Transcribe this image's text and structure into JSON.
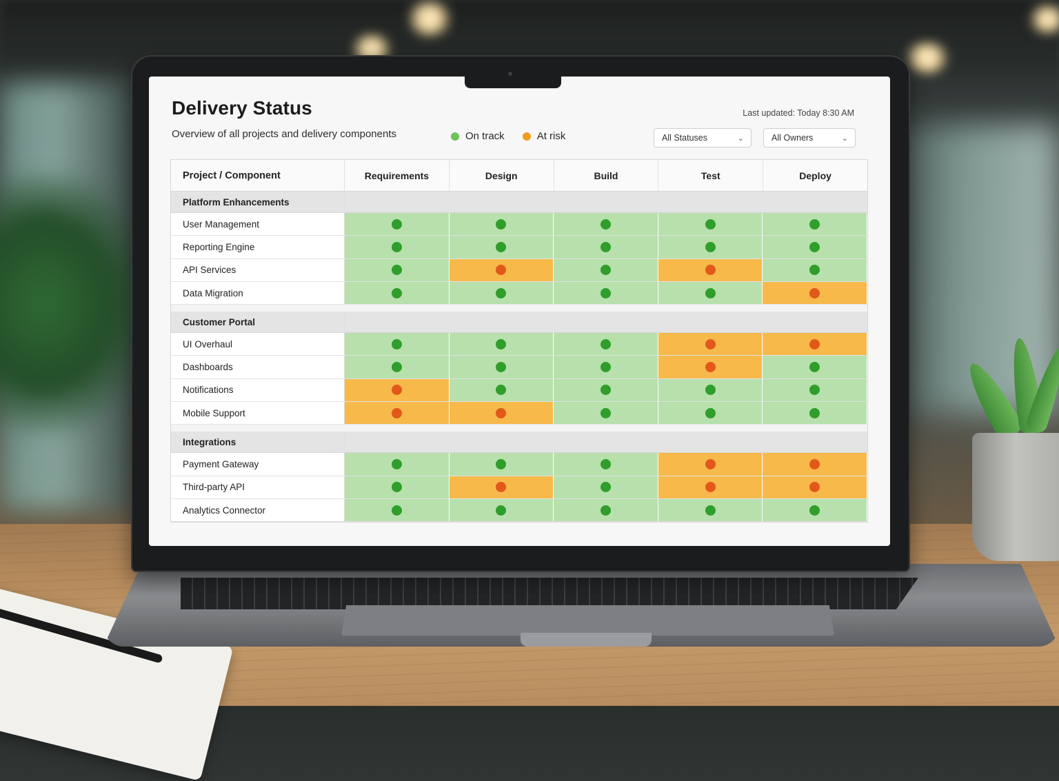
{
  "app": {
    "title": "Delivery Status",
    "subtitle": "Overview of all projects and delivery components",
    "last_updated": "Last updated: Today 8:30 AM"
  },
  "legend": [
    {
      "label": "On track",
      "color": "#6cc45a"
    },
    {
      "label": "At risk",
      "color": "#f39c23"
    }
  ],
  "filters": {
    "status": "All Statuses",
    "owner": "All Owners"
  },
  "colors": {
    "on_track_bg": "#b7e0ad",
    "on_track_dot": "#2f9e2a",
    "at_risk_bg": "#f6b94a",
    "at_risk_dot": "#e2581b"
  },
  "table": {
    "first_col_header": "Project / Component",
    "columns": [
      "Requirements",
      "Design",
      "Build",
      "Test",
      "Deploy"
    ],
    "groups": [
      {
        "name": "Platform Enhancements",
        "rows": [
          {
            "label": "User Management",
            "status": [
              "on_track",
              "on_track",
              "on_track",
              "on_track",
              "on_track"
            ]
          },
          {
            "label": "Reporting Engine",
            "status": [
              "on_track",
              "on_track",
              "on_track",
              "on_track",
              "on_track"
            ]
          },
          {
            "label": "API Services",
            "status": [
              "on_track",
              "at_risk",
              "on_track",
              "at_risk",
              "on_track"
            ]
          },
          {
            "label": "Data Migration",
            "status": [
              "on_track",
              "on_track",
              "on_track",
              "on_track",
              "at_risk"
            ]
          }
        ]
      },
      {
        "name": "Customer Portal",
        "rows": [
          {
            "label": "UI Overhaul",
            "status": [
              "on_track",
              "on_track",
              "on_track",
              "at_risk",
              "at_risk"
            ]
          },
          {
            "label": "Dashboards",
            "status": [
              "on_track",
              "on_track",
              "on_track",
              "at_risk",
              "on_track"
            ]
          },
          {
            "label": "Notifications",
            "status": [
              "at_risk",
              "on_track",
              "on_track",
              "on_track",
              "on_track"
            ]
          },
          {
            "label": "Mobile Support",
            "status": [
              "at_risk",
              "at_risk",
              "on_track",
              "on_track",
              "on_track"
            ]
          }
        ]
      },
      {
        "name": "Integrations",
        "rows": [
          {
            "label": "Payment Gateway",
            "status": [
              "on_track",
              "on_track",
              "on_track",
              "at_risk",
              "at_risk"
            ]
          },
          {
            "label": "Third-party API",
            "status": [
              "on_track",
              "at_risk",
              "on_track",
              "at_risk",
              "at_risk"
            ]
          },
          {
            "label": "Analytics Connector",
            "status": [
              "on_track",
              "on_track",
              "on_track",
              "on_track",
              "on_track"
            ]
          }
        ]
      }
    ]
  }
}
